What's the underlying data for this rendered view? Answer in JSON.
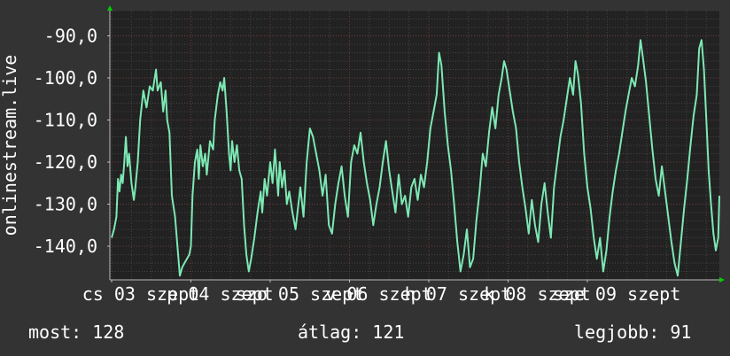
{
  "colors": {
    "background": "#333333",
    "plot_background": "#222222",
    "line": "#7de8b4",
    "grid_minor": "#444444",
    "grid_major": "#6e3a3a",
    "axis_arrow": "#00cc00",
    "text": "#ffffff"
  },
  "chart_data": {
    "type": "line",
    "title": "",
    "xlabel": "",
    "ylabel": "onlinestream.live",
    "ylim": [
      -148,
      -84
    ],
    "grid": true,
    "yticks": [
      {
        "value": -90,
        "label": "-90,0"
      },
      {
        "value": -100,
        "label": "-100,0"
      },
      {
        "value": -110,
        "label": "-110,0"
      },
      {
        "value": -120,
        "label": "-120,0"
      },
      {
        "value": -130,
        "label": "-130,0"
      },
      {
        "value": -140,
        "label": "-140,0"
      }
    ],
    "xlim": [
      0,
      7.55
    ],
    "xticks": [
      {
        "value": 0,
        "label": "cs 03 szept"
      },
      {
        "value": 1,
        "label": "p 04 szept"
      },
      {
        "value": 2,
        "label": "szo 05 szept"
      },
      {
        "value": 3,
        "label": "v 06 szept"
      },
      {
        "value": 4,
        "label": "h 07 szept"
      },
      {
        "value": 5,
        "label": "k 08 szept"
      },
      {
        "value": 6,
        "label": "sze 09 szept"
      }
    ],
    "series": [
      {
        "values": [
          [
            0.0,
            -138
          ],
          [
            0.03,
            -136
          ],
          [
            0.06,
            -133
          ],
          [
            0.08,
            -124
          ],
          [
            0.1,
            -127
          ],
          [
            0.12,
            -123
          ],
          [
            0.14,
            -125
          ],
          [
            0.16,
            -120
          ],
          [
            0.18,
            -114
          ],
          [
            0.2,
            -121
          ],
          [
            0.22,
            -118
          ],
          [
            0.25,
            -125
          ],
          [
            0.28,
            -129
          ],
          [
            0.3,
            -126
          ],
          [
            0.33,
            -120
          ],
          [
            0.36,
            -110
          ],
          [
            0.4,
            -103
          ],
          [
            0.44,
            -107
          ],
          [
            0.48,
            -102
          ],
          [
            0.52,
            -103
          ],
          [
            0.56,
            -98
          ],
          [
            0.58,
            -103
          ],
          [
            0.62,
            -101
          ],
          [
            0.65,
            -108
          ],
          [
            0.68,
            -103
          ],
          [
            0.7,
            -110
          ],
          [
            0.73,
            -113
          ],
          [
            0.76,
            -128
          ],
          [
            0.8,
            -133
          ],
          [
            0.83,
            -140
          ],
          [
            0.86,
            -147
          ],
          [
            0.89,
            -145
          ],
          [
            0.92,
            -144
          ],
          [
            0.95,
            -143
          ],
          [
            0.98,
            -142
          ],
          [
            1.0,
            -140
          ],
          [
            1.02,
            -128
          ],
          [
            1.05,
            -120
          ],
          [
            1.08,
            -117
          ],
          [
            1.1,
            -124
          ],
          [
            1.12,
            -116
          ],
          [
            1.15,
            -121
          ],
          [
            1.18,
            -118
          ],
          [
            1.2,
            -123
          ],
          [
            1.24,
            -115
          ],
          [
            1.28,
            -117
          ],
          [
            1.3,
            -110
          ],
          [
            1.34,
            -104
          ],
          [
            1.37,
            -101
          ],
          [
            1.4,
            -103
          ],
          [
            1.42,
            -100
          ],
          [
            1.45,
            -108
          ],
          [
            1.48,
            -118
          ],
          [
            1.5,
            -122
          ],
          [
            1.52,
            -115
          ],
          [
            1.55,
            -120
          ],
          [
            1.58,
            -116
          ],
          [
            1.61,
            -122
          ],
          [
            1.64,
            -124
          ],
          [
            1.67,
            -135
          ],
          [
            1.7,
            -142
          ],
          [
            1.73,
            -146
          ],
          [
            1.76,
            -143
          ],
          [
            1.8,
            -138
          ],
          [
            1.84,
            -132
          ],
          [
            1.88,
            -127
          ],
          [
            1.9,
            -132
          ],
          [
            1.93,
            -124
          ],
          [
            1.96,
            -128
          ],
          [
            2.0,
            -120
          ],
          [
            2.03,
            -125
          ],
          [
            2.06,
            -117
          ],
          [
            2.1,
            -128
          ],
          [
            2.12,
            -120
          ],
          [
            2.15,
            -126
          ],
          [
            2.18,
            -122
          ],
          [
            2.21,
            -130
          ],
          [
            2.24,
            -127
          ],
          [
            2.28,
            -132
          ],
          [
            2.32,
            -136
          ],
          [
            2.35,
            -131
          ],
          [
            2.38,
            -126
          ],
          [
            2.42,
            -133
          ],
          [
            2.46,
            -120
          ],
          [
            2.5,
            -112
          ],
          [
            2.54,
            -114
          ],
          [
            2.58,
            -118
          ],
          [
            2.62,
            -122
          ],
          [
            2.66,
            -128
          ],
          [
            2.7,
            -123
          ],
          [
            2.74,
            -135
          ],
          [
            2.78,
            -137
          ],
          [
            2.82,
            -130
          ],
          [
            2.86,
            -125
          ],
          [
            2.9,
            -121
          ],
          [
            2.94,
            -128
          ],
          [
            2.98,
            -133
          ],
          [
            3.02,
            -120
          ],
          [
            3.06,
            -116
          ],
          [
            3.1,
            -118
          ],
          [
            3.14,
            -113
          ],
          [
            3.18,
            -120
          ],
          [
            3.22,
            -125
          ],
          [
            3.26,
            -129
          ],
          [
            3.3,
            -135
          ],
          [
            3.34,
            -130
          ],
          [
            3.38,
            -126
          ],
          [
            3.42,
            -120
          ],
          [
            3.46,
            -115
          ],
          [
            3.5,
            -122
          ],
          [
            3.54,
            -127
          ],
          [
            3.58,
            -132
          ],
          [
            3.62,
            -123
          ],
          [
            3.66,
            -130
          ],
          [
            3.7,
            -128
          ],
          [
            3.74,
            -133
          ],
          [
            3.78,
            -126
          ],
          [
            3.82,
            -124
          ],
          [
            3.86,
            -129
          ],
          [
            3.9,
            -123
          ],
          [
            3.94,
            -126
          ],
          [
            3.98,
            -120
          ],
          [
            4.02,
            -112
          ],
          [
            4.06,
            -108
          ],
          [
            4.1,
            -104
          ],
          [
            4.13,
            -94
          ],
          [
            4.16,
            -97
          ],
          [
            4.2,
            -108
          ],
          [
            4.24,
            -116
          ],
          [
            4.28,
            -122
          ],
          [
            4.32,
            -130
          ],
          [
            4.36,
            -139
          ],
          [
            4.4,
            -146
          ],
          [
            4.44,
            -142
          ],
          [
            4.48,
            -136
          ],
          [
            4.52,
            -145
          ],
          [
            4.56,
            -143
          ],
          [
            4.6,
            -134
          ],
          [
            4.64,
            -127
          ],
          [
            4.68,
            -118
          ],
          [
            4.72,
            -121
          ],
          [
            4.76,
            -113
          ],
          [
            4.8,
            -107
          ],
          [
            4.84,
            -112
          ],
          [
            4.88,
            -104
          ],
          [
            4.92,
            -100
          ],
          [
            4.95,
            -96
          ],
          [
            4.98,
            -98
          ],
          [
            5.02,
            -103
          ],
          [
            5.06,
            -108
          ],
          [
            5.1,
            -112
          ],
          [
            5.14,
            -120
          ],
          [
            5.18,
            -126
          ],
          [
            5.22,
            -131
          ],
          [
            5.26,
            -137
          ],
          [
            5.3,
            -129
          ],
          [
            5.34,
            -135
          ],
          [
            5.38,
            -139
          ],
          [
            5.42,
            -130
          ],
          [
            5.46,
            -125
          ],
          [
            5.5,
            -132
          ],
          [
            5.54,
            -138
          ],
          [
            5.58,
            -126
          ],
          [
            5.62,
            -120
          ],
          [
            5.66,
            -114
          ],
          [
            5.7,
            -110
          ],
          [
            5.74,
            -105
          ],
          [
            5.78,
            -100
          ],
          [
            5.82,
            -104
          ],
          [
            5.85,
            -96
          ],
          [
            5.88,
            -99
          ],
          [
            5.92,
            -106
          ],
          [
            5.96,
            -118
          ],
          [
            6.0,
            -126
          ],
          [
            6.04,
            -131
          ],
          [
            6.08,
            -138
          ],
          [
            6.12,
            -143
          ],
          [
            6.16,
            -138
          ],
          [
            6.2,
            -146
          ],
          [
            6.24,
            -141
          ],
          [
            6.28,
            -133
          ],
          [
            6.32,
            -127
          ],
          [
            6.36,
            -122
          ],
          [
            6.4,
            -118
          ],
          [
            6.44,
            -113
          ],
          [
            6.48,
            -108
          ],
          [
            6.52,
            -104
          ],
          [
            6.56,
            -100
          ],
          [
            6.6,
            -102
          ],
          [
            6.64,
            -97
          ],
          [
            6.67,
            -91
          ],
          [
            6.7,
            -95
          ],
          [
            6.74,
            -101
          ],
          [
            6.78,
            -109
          ],
          [
            6.82,
            -117
          ],
          [
            6.86,
            -124
          ],
          [
            6.9,
            -128
          ],
          [
            6.94,
            -121
          ],
          [
            6.98,
            -127
          ],
          [
            7.02,
            -133
          ],
          [
            7.06,
            -139
          ],
          [
            7.1,
            -144
          ],
          [
            7.14,
            -147
          ],
          [
            7.18,
            -139
          ],
          [
            7.22,
            -131
          ],
          [
            7.26,
            -124
          ],
          [
            7.3,
            -116
          ],
          [
            7.34,
            -109
          ],
          [
            7.38,
            -104
          ],
          [
            7.41,
            -93
          ],
          [
            7.44,
            -91
          ],
          [
            7.47,
            -98
          ],
          [
            7.5,
            -110
          ],
          [
            7.53,
            -122
          ],
          [
            7.56,
            -130
          ],
          [
            7.59,
            -137
          ],
          [
            7.62,
            -141
          ],
          [
            7.65,
            -138
          ],
          [
            7.68,
            -128
          ]
        ]
      }
    ]
  },
  "stats": {
    "now_label": "most:",
    "now_value": "128",
    "avg_label": "átlag:",
    "avg_value": "121",
    "max_label": "legjobb:",
    "max_value": "91"
  }
}
